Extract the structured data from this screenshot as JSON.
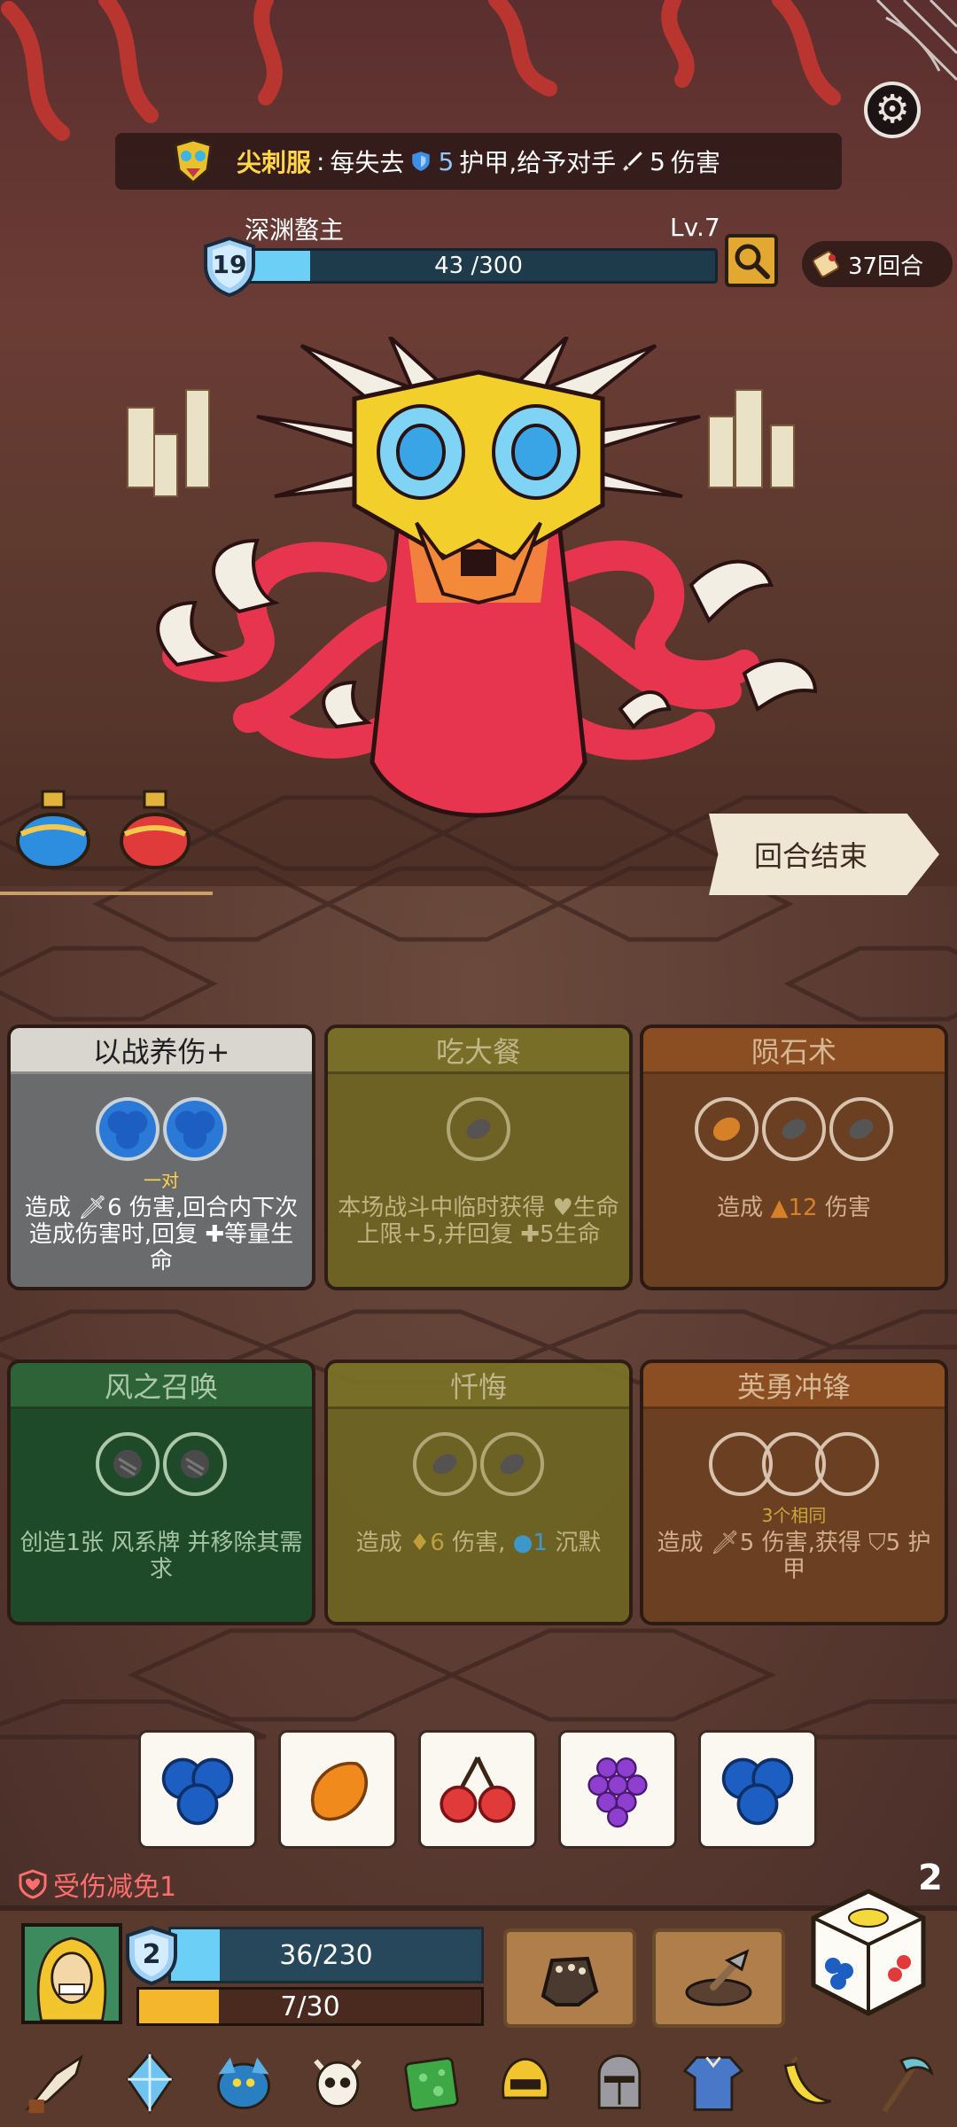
{
  "relic_banner": {
    "name": "尖刺服",
    "separator": ":",
    "text_lose": "每失去",
    "armor_value": "5",
    "text_armor": "护甲,给予对手",
    "damage_value": "5",
    "text_damage": "伤害"
  },
  "enemy": {
    "name": "深渊螯主",
    "level": "Lv.7",
    "armor": "19",
    "hp_text": "43 /300",
    "hp_fraction": 0.1433
  },
  "turn_counter": "37回合",
  "end_turn_label": "回合结束",
  "cards": [
    {
      "title": "以战养伤+",
      "sub": "一对",
      "desc": "造成 🗡6 伤害,回合内下次造成伤害时,回复 ✚等量生命"
    },
    {
      "title": "吃大餐",
      "desc": "本场战斗中临时获得 ♥生命上限+5,并回复 ✚5生命"
    },
    {
      "title": "陨石术",
      "desc_prefix": "造成",
      "desc_value": "12",
      "desc_suffix": "伤害"
    },
    {
      "title": "风之召唤",
      "desc": "创造1张 风系牌 并移除其需求"
    },
    {
      "title": "忏悔",
      "desc_prefix": "造成",
      "desc_value": "6",
      "desc_mid": "伤害,",
      "desc_value2": "1",
      "desc_suffix": "沉默"
    },
    {
      "title": "英勇冲锋",
      "sub": "3个相同",
      "desc": "造成 🗡5 伤害,获得 ⛉5 护甲"
    }
  ],
  "dice_tray": [
    "blueberry",
    "mango",
    "cherry",
    "grape",
    "blueberry"
  ],
  "status": {
    "damage_reduction": "受伤减免1",
    "dice_count": "2"
  },
  "player": {
    "armor": "2",
    "hp_text": "36/230",
    "hp_fraction": 0.1565,
    "xp_text": "7/30",
    "xp_fraction": 0.2333
  },
  "colors": {
    "hp_fill": "#6ccff5",
    "xp_fill": "#f4b72b",
    "accent_yellow": "#ffd54a",
    "danger_red": "#ff6d6d"
  },
  "relics": [
    "horn-icon",
    "crystal-icon",
    "dragon-icon",
    "skull-icon",
    "slime-icon",
    "golden-helmet-icon",
    "knight-helmet-icon",
    "tunic-icon",
    "banana-icon",
    "scythe-icon"
  ]
}
